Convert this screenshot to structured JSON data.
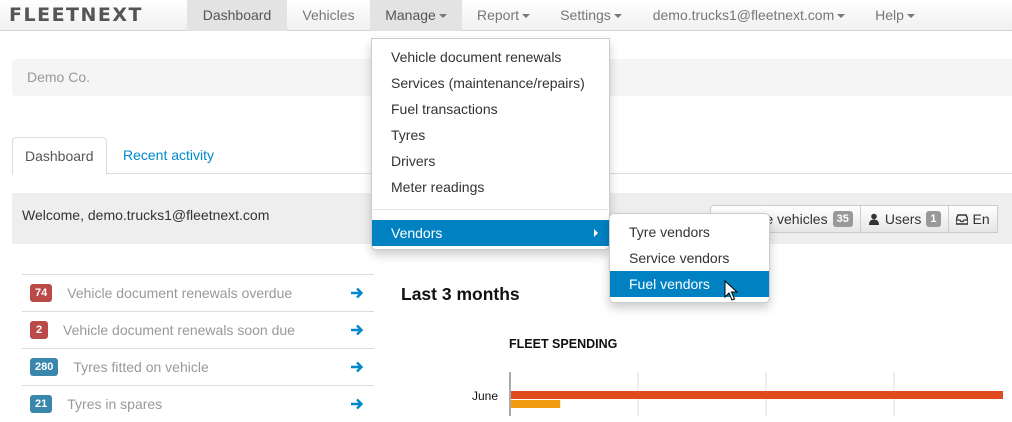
{
  "brand": "FLEETNEXT",
  "nav": {
    "dashboard": "Dashboard",
    "vehicles": "Vehicles",
    "manage": "Manage",
    "report": "Report",
    "settings": "Settings",
    "account": "demo.trucks1@fleetnext.com",
    "help": "Help"
  },
  "breadcrumb": "Demo Co.",
  "tabs": {
    "dashboard": "Dashboard",
    "recent": "Recent activity"
  },
  "welcome": "Welcome, demo.trucks1@fleetnext.com",
  "toolbar": {
    "active_vehicles": "Active vehicles",
    "active_vehicles_count": "35",
    "users": "Users",
    "users_count": "1",
    "email_partial": "En"
  },
  "alerts": [
    {
      "count": "74",
      "label": "Vehicle document renewals overdue",
      "color": "#b94a48"
    },
    {
      "count": "2",
      "label": "Vehicle document renewals soon due",
      "color": "#b94a48"
    },
    {
      "count": "280",
      "label": "Tyres fitted on vehicle",
      "color": "#3a87ad"
    },
    {
      "count": "21",
      "label": "Tyres in spares",
      "color": "#3a87ad"
    }
  ],
  "section_title": "Last 3 months",
  "chart_data": {
    "type": "bar",
    "title": "FLEET SPENDING",
    "categories": [
      "June"
    ],
    "series": [
      {
        "values": [
          100
        ],
        "color": "#e04a1f"
      },
      {
        "values": [
          10
        ],
        "color": "#f39c12"
      }
    ]
  },
  "manage_menu": {
    "items": [
      "Vehicle document renewals",
      "Services (maintenance/repairs)",
      "Fuel transactions",
      "Tyres",
      "Drivers",
      "Meter readings"
    ],
    "vendors": "Vendors"
  },
  "vendors_menu": {
    "items": [
      "Tyre vendors",
      "Service vendors",
      "Fuel vendors"
    ],
    "selected": "Fuel vendors"
  },
  "colors": {
    "highlight": "#0081c2",
    "link": "#0088cc"
  }
}
